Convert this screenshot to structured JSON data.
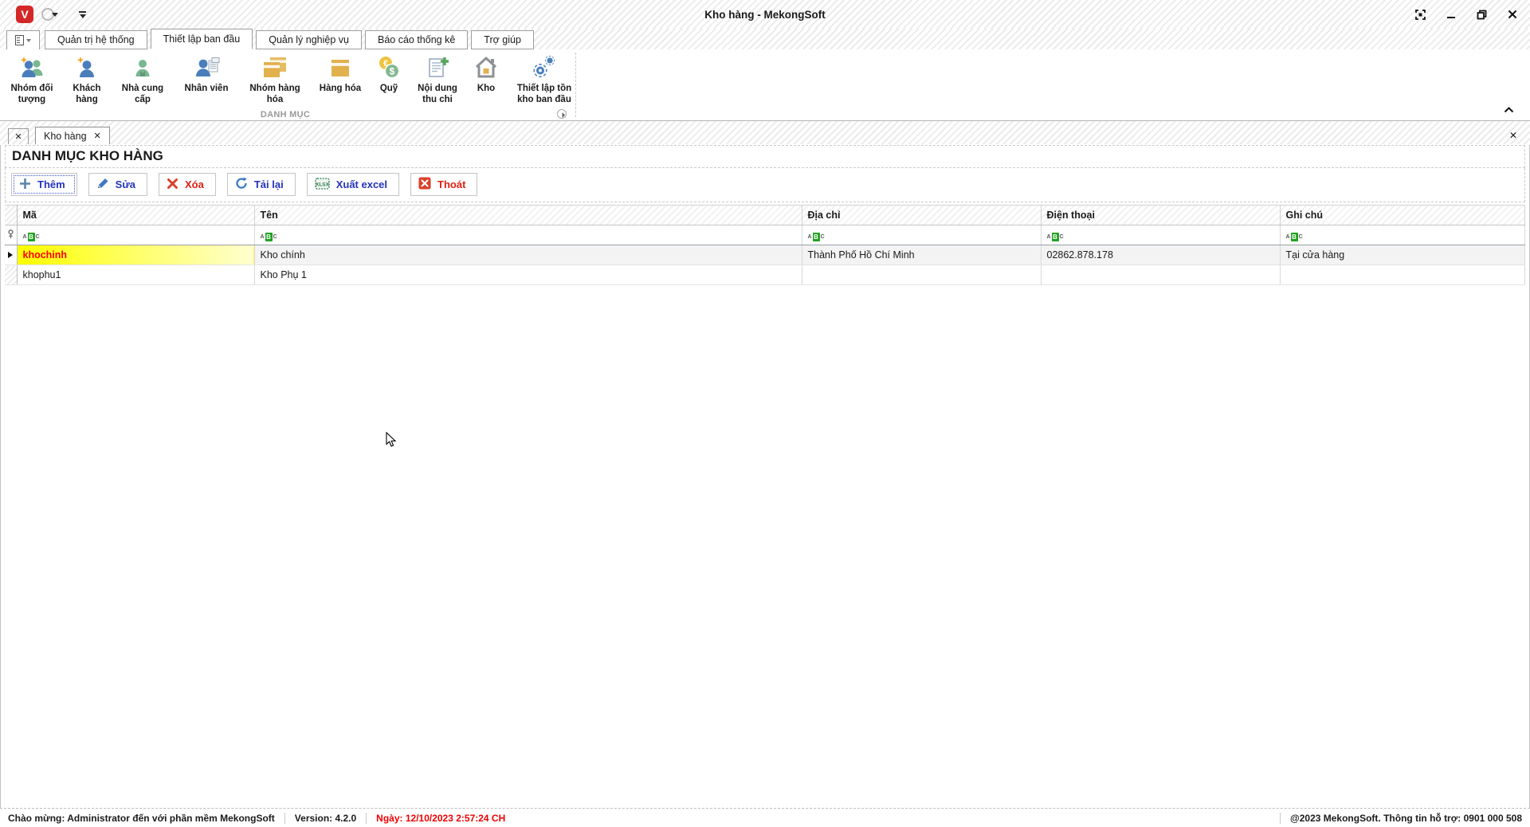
{
  "window": {
    "title": "Kho hàng - MekongSoft",
    "logo_letter": "V"
  },
  "ribbon": {
    "active_tab": "Thiết lập ban đầu",
    "tabs": [
      {
        "label": "Quản trị hệ thống"
      },
      {
        "label": "Thiết lập ban đầu"
      },
      {
        "label": "Quản lý nghiệp vụ"
      },
      {
        "label": "Báo cáo thống kê"
      },
      {
        "label": "Trợ giúp"
      }
    ],
    "group_label": "DANH MỤC",
    "items": [
      {
        "label": "Nhóm đối tượng",
        "icon": "object-group-icon"
      },
      {
        "label": "Khách hàng",
        "icon": "customer-icon"
      },
      {
        "label": "Nhà cung cấp",
        "icon": "supplier-icon"
      },
      {
        "label": "Nhân viên",
        "icon": "employee-icon"
      },
      {
        "label": "Nhóm hàng hóa",
        "icon": "product-group-icon"
      },
      {
        "label": "Hàng hóa",
        "icon": "product-icon"
      },
      {
        "label": "Quỹ",
        "icon": "fund-coins-icon"
      },
      {
        "label": "Nội dung thu chi",
        "icon": "income-expense-icon"
      },
      {
        "label": "Kho",
        "icon": "warehouse-icon"
      },
      {
        "label": "Thiết lập tồn kho ban đầu",
        "icon": "initial-stock-gears-icon"
      }
    ]
  },
  "document_tabs": {
    "tabs": [
      {
        "label": "Kho hàng"
      }
    ]
  },
  "page": {
    "title": "DANH MỤC KHO HÀNG",
    "toolbar": {
      "buttons": [
        {
          "label": "Thêm"
        },
        {
          "label": "Sửa"
        },
        {
          "label": "Xóa"
        },
        {
          "label": "Tải lại"
        },
        {
          "label": "Xuất excel"
        },
        {
          "label": "Thoát"
        }
      ]
    }
  },
  "grid": {
    "columns": [
      "Mã",
      "Tên",
      "Địa chỉ",
      "Điện thoại",
      "Ghi chú"
    ],
    "filter_letters": {
      "a": "A",
      "b": "B",
      "c": "C"
    },
    "rows": [
      {
        "ma": "khochinh",
        "ten": "Kho chính",
        "dia_chi": "Thành Phố Hồ Chí Minh",
        "dien_thoai": "02862.878.178",
        "ghi_chu": "Tại cửa hàng"
      },
      {
        "ma": "khophu1",
        "ten": "Kho Phụ 1",
        "dia_chi": "",
        "dien_thoai": "",
        "ghi_chu": ""
      }
    ]
  },
  "status_bar": {
    "welcome": "Chào mừng: Administrator đến với phần mềm MekongSoft",
    "version": "Version: 4.2.0",
    "date": "Ngày: 12/10/2023 2:57:24 CH",
    "support": "@2023 MekongSoft. Thông tin hỗ trợ: 0901 000 508"
  },
  "colors": {
    "accent-blue": "#2333bb",
    "accent-red": "#dd2010",
    "selected-text-red": "#ff0000",
    "filter-green": "#21a121",
    "logo-red": "#d42828"
  }
}
